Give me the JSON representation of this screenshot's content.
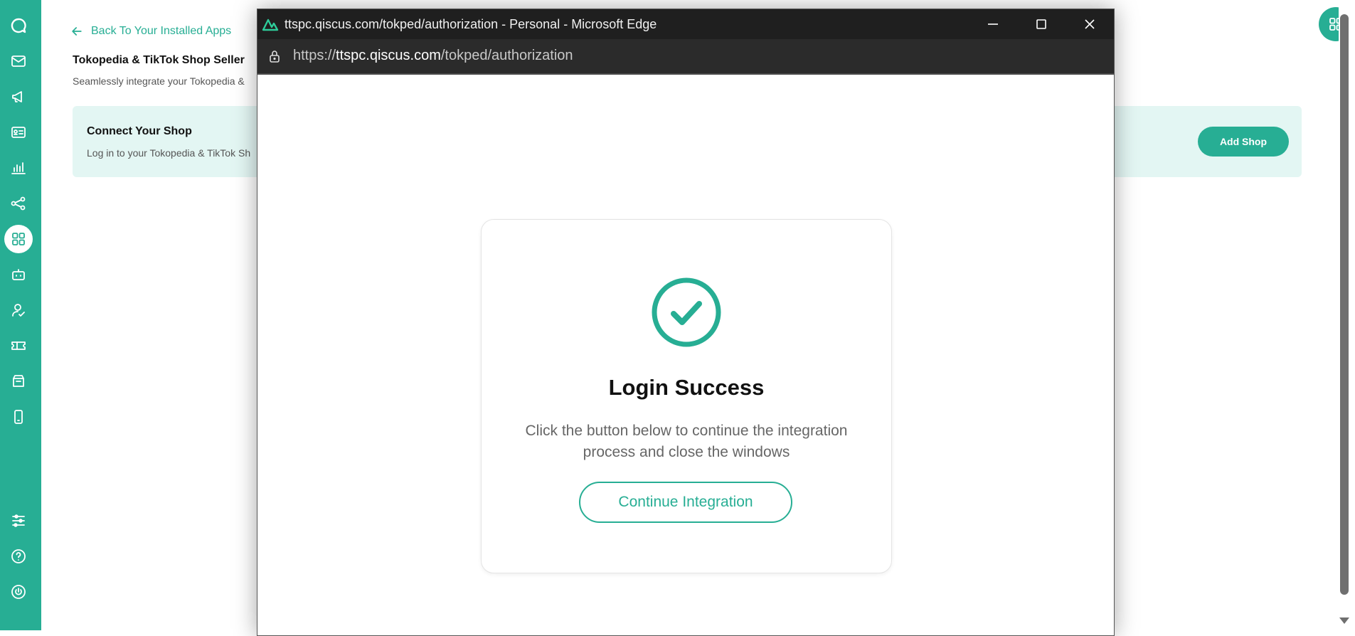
{
  "colors": {
    "accent": "#27ae94",
    "accent_light": "#e3f6f3",
    "titlebar": "#1f1f1f"
  },
  "sidebar": {
    "items": [
      {
        "icon": "chat-logo-icon"
      },
      {
        "icon": "inbox-icon"
      },
      {
        "icon": "megaphone-icon"
      },
      {
        "icon": "contact-card-icon"
      },
      {
        "icon": "analytics-icon"
      },
      {
        "icon": "share-icon"
      },
      {
        "icon": "apps-icon",
        "active": true
      },
      {
        "icon": "bot-icon"
      },
      {
        "icon": "agent-icon"
      },
      {
        "icon": "ticket-icon"
      },
      {
        "icon": "archive-icon"
      },
      {
        "icon": "mobile-icon"
      },
      {
        "icon": "settings-sliders-icon"
      },
      {
        "icon": "help-icon"
      },
      {
        "icon": "power-icon"
      }
    ]
  },
  "page": {
    "back_label": "Back To Your Installed Apps",
    "app_title": "Tokopedia & TikTok Shop Seller",
    "app_desc": "Seamlessly integrate your Tokopedia &",
    "connect": {
      "title": "Connect Your Shop",
      "desc": "Log in to your Tokopedia & TikTok Sh",
      "add_shop_label": "Add Shop"
    }
  },
  "popup": {
    "window_title": "ttspc.qiscus.com/tokped/authorization - Personal - Microsoft Edge",
    "url_scheme": "https://",
    "url_host": "ttspc.qiscus.com",
    "url_path": "/tokped/authorization",
    "success": {
      "title": "Login Success",
      "desc": "Click the button below to continue the integration process and close the windows",
      "button_label": "Continue Integration"
    }
  }
}
